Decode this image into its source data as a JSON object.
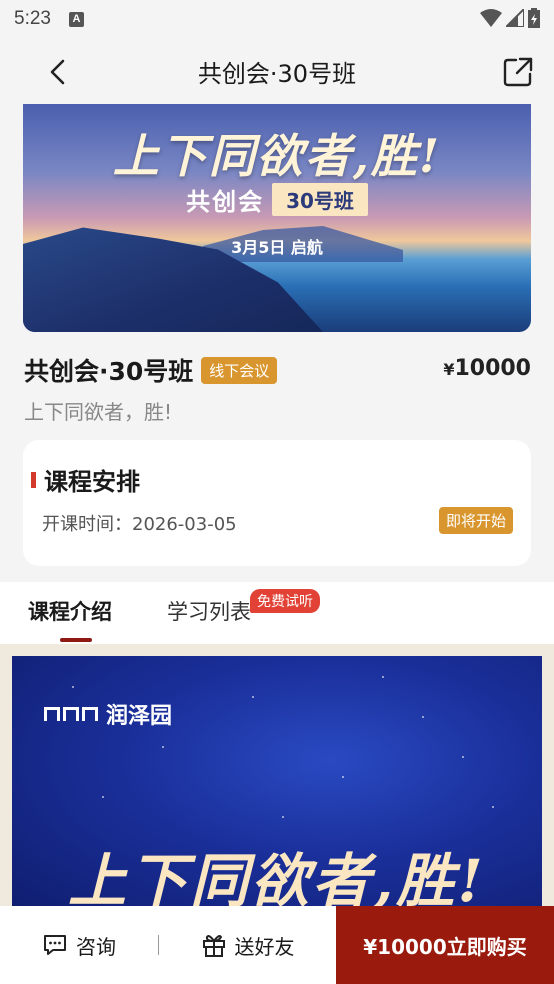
{
  "status_bar": {
    "time": "5:23",
    "notification_letter": "A"
  },
  "header": {
    "title": "共创会·30号班"
  },
  "banner": {
    "headline": "上下同欲者,胜!",
    "sub_left": "共创会",
    "sub_pill": "30号班",
    "date": "3月5日 启航"
  },
  "course": {
    "title": "共创会·30号班",
    "tag": "线下会议",
    "price_symbol": "¥",
    "price_value": "10000",
    "subtitle": "上下同欲者，胜!"
  },
  "schedule": {
    "title": "课程安排",
    "start_time": "开课时间：2026-03-05",
    "status": "即将开始"
  },
  "tabs": {
    "intro": "课程介绍",
    "list": "学习列表",
    "free_badge": "免费试听"
  },
  "poster": {
    "brand": "润泽园",
    "headline": "上下同欲者,胜!"
  },
  "bottom_bar": {
    "consult": "咨询",
    "gift": "送好友",
    "buy": "¥10000立即购买"
  },
  "colors": {
    "accent": "#9a1a0e",
    "tag": "#d9962e",
    "badge_red": "#e24236"
  }
}
